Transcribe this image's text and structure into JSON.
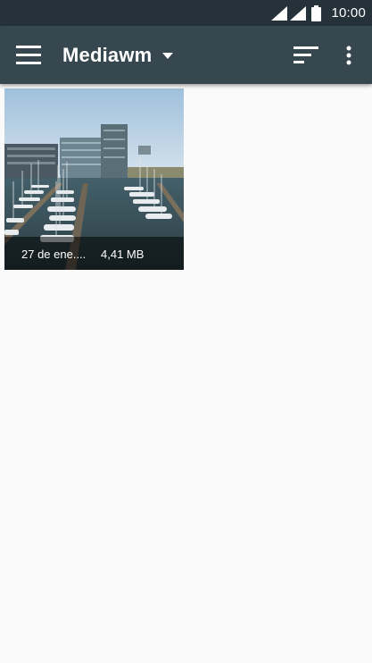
{
  "status_bar": {
    "time": "10:00"
  },
  "app_bar": {
    "title": "Mediawm",
    "icons": {
      "menu": "hamburger-menu-icon",
      "sort": "sort-icon",
      "more": "more-vertical-icon",
      "dropdown": "dropdown-caret-icon"
    }
  },
  "gallery": {
    "items": [
      {
        "date": "27 de ene....",
        "size": "4,41 MB"
      }
    ]
  },
  "colors": {
    "status_bar": "#26323a",
    "app_bar": "#37474f",
    "background": "#fafafa"
  }
}
